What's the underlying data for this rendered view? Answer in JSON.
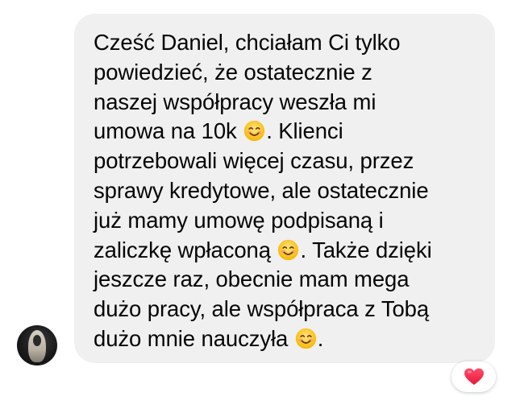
{
  "message": {
    "lines": [
      [
        "Cześć Daniel, chciałam Ci tylko"
      ],
      [
        "powiedzieć, że ostatecznie z"
      ],
      [
        "naszej współpracy weszła mi"
      ],
      [
        "umowa na 10k ",
        "",
        ". Klienci"
      ],
      [
        "potrzebowali więcej czasu, przez"
      ],
      [
        "sprawy kredytowe, ale ostatecznie"
      ],
      [
        "już mamy umowę podpisaną i"
      ],
      [
        "zaliczkę wpłaconą ",
        "",
        ". Także dzięki"
      ],
      [
        "jeszcze raz, obecnie mam mega"
      ],
      [
        "dużo pracy, ale współpraca z Tobą"
      ],
      [
        "dużo mnie nauczyła ",
        "",
        "."
      ]
    ],
    "emoji_name": "smiling-face-with-smiling-eyes-icon"
  },
  "reaction": {
    "icon": "red-heart-icon",
    "color": "#f0284a"
  },
  "colors": {
    "bubble": "#f0f0f0",
    "text": "#050505"
  }
}
